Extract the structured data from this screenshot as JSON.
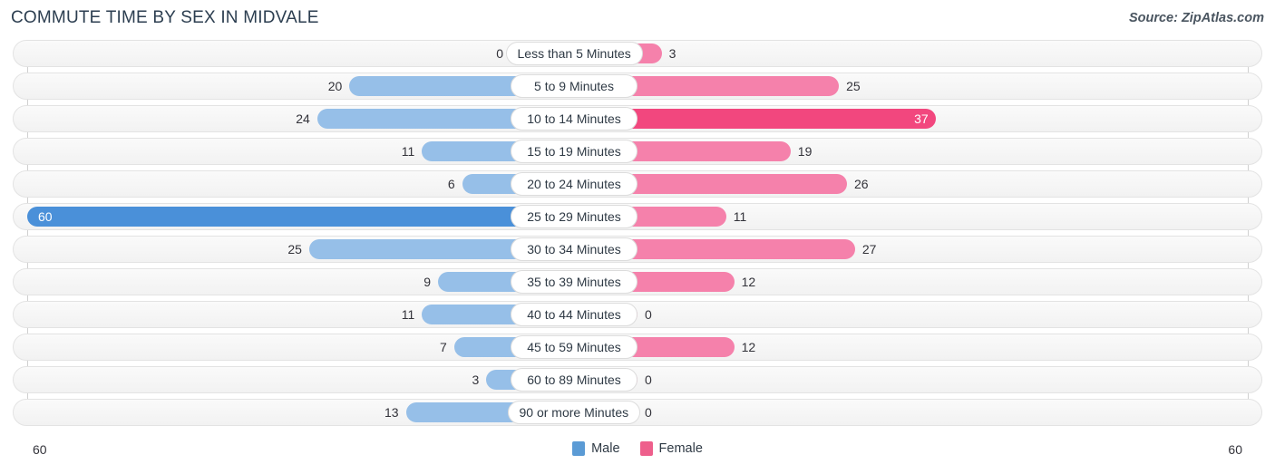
{
  "header": {
    "title": "COMMUTE TIME BY SEX IN MIDVALE",
    "source": "Source: ZipAtlas.com"
  },
  "axis": {
    "left_label": "60",
    "right_label": "60"
  },
  "legend": {
    "items": [
      {
        "label": "Male",
        "color": "#5b9bd5",
        "name": "legend-male"
      },
      {
        "label": "Female",
        "color": "#ee5f8c",
        "name": "legend-female"
      }
    ]
  },
  "chart_data": {
    "type": "bar",
    "title": "COMMUTE TIME BY SEX IN MIDVALE",
    "subtitle": "Source: ZipAtlas.com",
    "orientation": "horizontal-diverging",
    "xlabel": "",
    "ylabel": "",
    "axis_max": 60,
    "axis_left_tick": 60,
    "axis_right_tick": 60,
    "grid": true,
    "legend_position": "bottom-center",
    "categories": [
      "Less than 5 Minutes",
      "5 to 9 Minutes",
      "10 to 14 Minutes",
      "15 to 19 Minutes",
      "20 to 24 Minutes",
      "25 to 29 Minutes",
      "30 to 34 Minutes",
      "35 to 39 Minutes",
      "40 to 44 Minutes",
      "45 to 59 Minutes",
      "60 to 89 Minutes",
      "90 or more Minutes"
    ],
    "series": [
      {
        "name": "Male",
        "color": "#96bfe8",
        "peak_color": "#4a90d9",
        "values": [
          0,
          20,
          24,
          11,
          6,
          60,
          25,
          9,
          11,
          7,
          3,
          13
        ]
      },
      {
        "name": "Female",
        "color": "#f581ab",
        "peak_color": "#f2477e",
        "values": [
          3,
          25,
          37,
          19,
          26,
          11,
          27,
          12,
          0,
          12,
          0,
          0
        ]
      }
    ]
  }
}
